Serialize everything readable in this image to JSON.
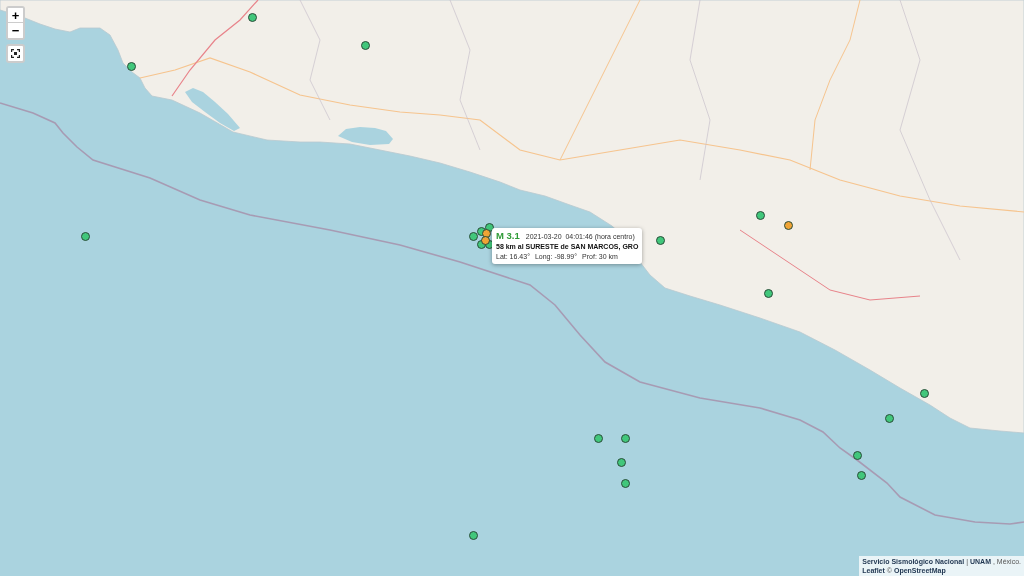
{
  "map": {
    "markers": [
      {
        "color": "#41c77b"
      },
      {
        "color": "#41c77b"
      },
      {
        "color": "#41c77b"
      },
      {
        "color": "#41c77b"
      },
      {
        "color": "#f1a435"
      },
      {
        "color": "#41c77b"
      },
      {
        "color": "#41c77b"
      },
      {
        "color": "#41c77b"
      },
      {
        "color": "#41c77b"
      },
      {
        "color": "#41c77b"
      },
      {
        "color": "#41c77b"
      },
      {
        "color": "#41c77b"
      },
      {
        "color": "#f1a435"
      },
      {
        "color": "#f1a435"
      },
      {
        "color": "#41c77b"
      },
      {
        "color": "#41c77b"
      },
      {
        "color": "#41c77b"
      },
      {
        "color": "#41c77b"
      },
      {
        "color": "#41c77b"
      },
      {
        "color": "#41c77b"
      },
      {
        "color": "#41c77b"
      },
      {
        "color": "#41c77b"
      },
      {
        "color": "#41c77b"
      },
      {
        "color": "#41c77b"
      }
    ]
  },
  "zoom_control": {
    "zoom_in": "+",
    "zoom_out": "−"
  },
  "popup": {
    "magnitude": "M 3.1",
    "datetime": "2021-03-20  04:01:46 (hora centro)",
    "location": "58 km al SURESTE de SAN MARCOS, GRO",
    "details": [
      "Lat: 16.43°",
      "Long: -98.99°",
      "Prof: 30 km"
    ]
  },
  "attribution": {
    "lines": [
      [
        {
          "kind": "link",
          "text": "Servicio Sismológico Nacional"
        },
        {
          "kind": "text",
          "text": "|"
        },
        {
          "kind": "link",
          "text": "UNAM"
        },
        {
          "kind": "text",
          "text": ", México."
        }
      ],
      [
        {
          "kind": "link",
          "text": "Leaflet"
        },
        {
          "kind": "text",
          "text": "©"
        },
        {
          "kind": "link",
          "text": "OpenStreetMap"
        }
      ]
    ]
  }
}
